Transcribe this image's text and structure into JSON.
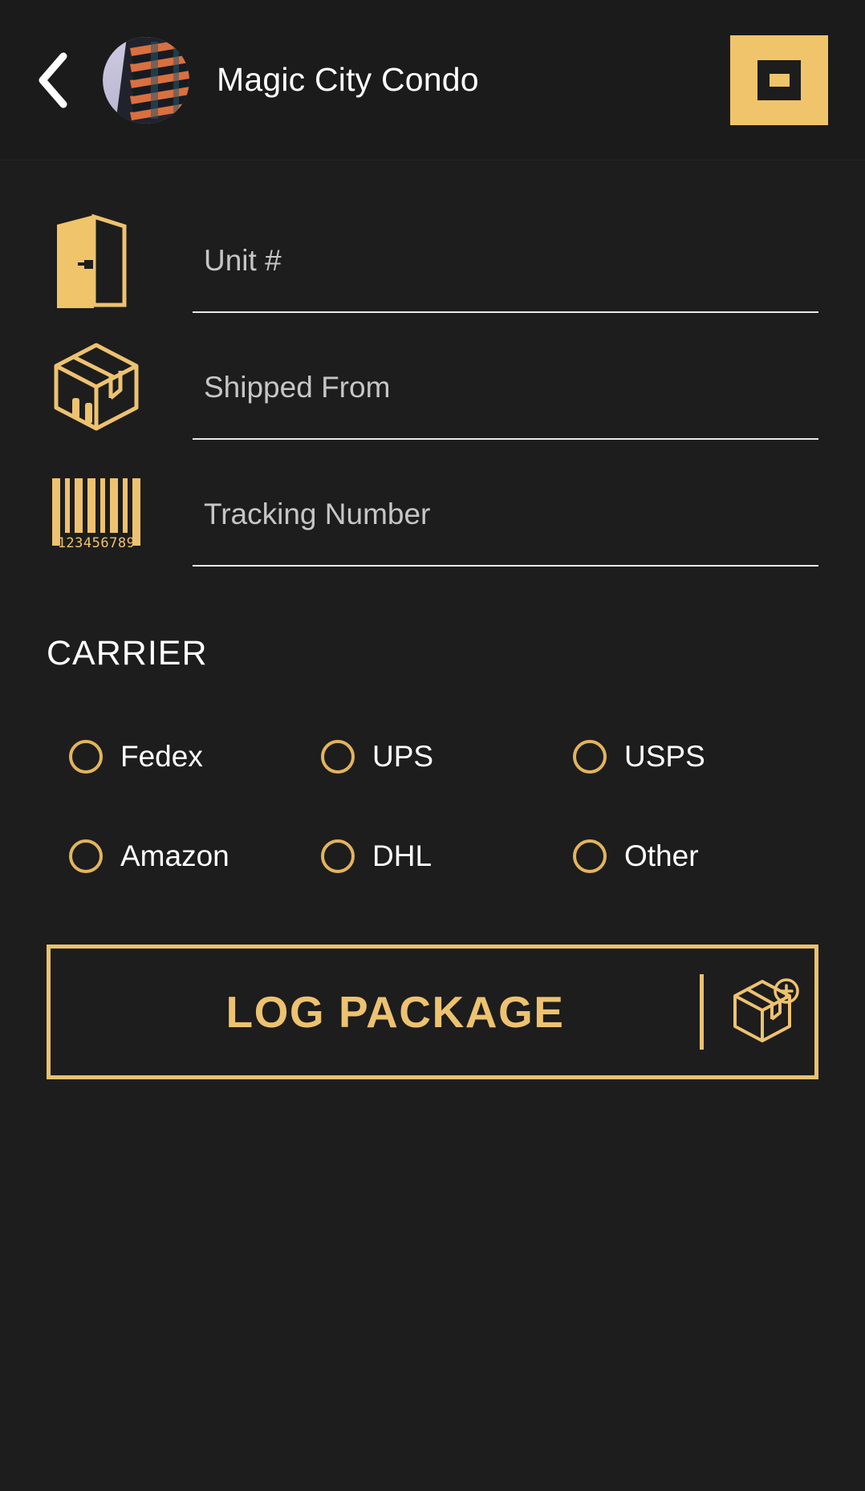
{
  "header": {
    "back_icon": "chevron-left-icon",
    "avatar_alt": "condo-building-photo",
    "title": "Magic City Condo",
    "action_icon": "qr-scan-icon"
  },
  "form": {
    "fields": [
      {
        "icon": "door-icon",
        "placeholder": "Unit #",
        "value": ""
      },
      {
        "icon": "package-box-icon",
        "placeholder": "Shipped From",
        "value": ""
      },
      {
        "icon": "barcode-icon",
        "placeholder": "Tracking Number",
        "value": ""
      }
    ],
    "barcode_digits": "123456789"
  },
  "carrier": {
    "heading": "CARRIER",
    "selected": "",
    "rows": [
      [
        {
          "label": "Fedex",
          "checked": false
        },
        {
          "label": "UPS",
          "checked": false
        },
        {
          "label": "USPS",
          "checked": false
        }
      ],
      [
        {
          "label": "Amazon",
          "checked": false
        },
        {
          "label": "DHL",
          "checked": false
        },
        {
          "label": "Other",
          "checked": false
        }
      ]
    ]
  },
  "submit": {
    "label": "LOG PACKAGE",
    "icon": "add-package-icon"
  },
  "colors": {
    "background": "#1d1d1d",
    "header_background": "#1b1b1b",
    "gold": "#e9c271",
    "gold_solid": "#f0c46a",
    "text_primary": "#ffffff",
    "text_placeholder": "#c6c6c6",
    "underline": "#e9e9e9"
  }
}
